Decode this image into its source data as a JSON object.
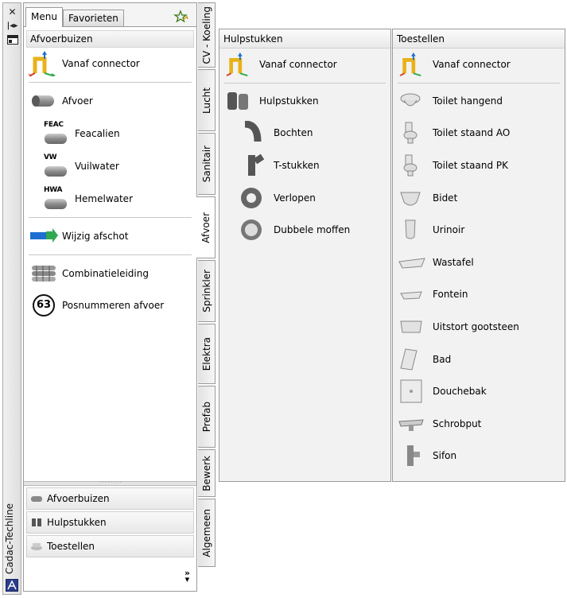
{
  "palette": {
    "title": "Cadac-Techline"
  },
  "tabs": [
    {
      "label": "Menu",
      "active": true
    },
    {
      "label": "Favorieten",
      "active": false
    }
  ],
  "main": {
    "header": "Afvoerbuizen",
    "items": [
      {
        "label": "Vanaf connector",
        "icon": "connector-icon"
      },
      {
        "label": "Afvoer",
        "icon": "pipe-icon"
      },
      {
        "label": "Feacalien",
        "icon": "pipe-feac-icon",
        "tag": "FEAC"
      },
      {
        "label": "Vuilwater",
        "icon": "pipe-vw-icon",
        "tag": "VW"
      },
      {
        "label": "Hemelwater",
        "icon": "pipe-hwa-icon",
        "tag": "HWA"
      },
      {
        "label": "Wijzig afschot",
        "icon": "slope-arrow-icon"
      },
      {
        "label": "Combinatieleiding",
        "icon": "combined-pipe-icon"
      },
      {
        "label": "Posnummeren afvoer",
        "icon": "number-63-icon",
        "tag": "63"
      }
    ]
  },
  "bottom_nav": [
    {
      "label": "Afvoerbuizen"
    },
    {
      "label": "Hulpstukken"
    },
    {
      "label": "Toestellen"
    }
  ],
  "more_glyph": "»",
  "vertical_tabs": [
    {
      "label": "CV - Koeling",
      "active": false
    },
    {
      "label": "Lucht",
      "active": false
    },
    {
      "label": "Sanitair",
      "active": false
    },
    {
      "label": "Afvoer",
      "active": true
    },
    {
      "label": "Sprinkler",
      "active": false
    },
    {
      "label": "Elektra",
      "active": false
    },
    {
      "label": "Prefab",
      "active": false
    },
    {
      "label": "Bewerk",
      "active": false
    },
    {
      "label": "Algemeen",
      "active": false
    }
  ],
  "hulpstukken": {
    "header": "Hulpstukken",
    "items": [
      {
        "label": "Vanaf connector"
      },
      {
        "label": "Hulpstukken"
      },
      {
        "label": "Bochten"
      },
      {
        "label": "T-stukken"
      },
      {
        "label": "Verlopen"
      },
      {
        "label": "Dubbele moffen"
      }
    ]
  },
  "toestellen": {
    "header": "Toestellen",
    "items": [
      {
        "label": "Vanaf connector"
      },
      {
        "label": "Toilet hangend"
      },
      {
        "label": "Toilet staand AO"
      },
      {
        "label": "Toilet staand PK"
      },
      {
        "label": "Bidet"
      },
      {
        "label": "Urinoir"
      },
      {
        "label": "Wastafel"
      },
      {
        "label": "Fontein"
      },
      {
        "label": "Uitstort gootsteen"
      },
      {
        "label": "Bad"
      },
      {
        "label": "Douchebak"
      },
      {
        "label": "Schrobput"
      },
      {
        "label": "Sifon"
      }
    ]
  },
  "colors": {
    "accent_green": "#2fa84f",
    "accent_blue": "#1e6fd0",
    "accent_red": "#d83a2a",
    "accent_yellow": "#e8b21a"
  }
}
